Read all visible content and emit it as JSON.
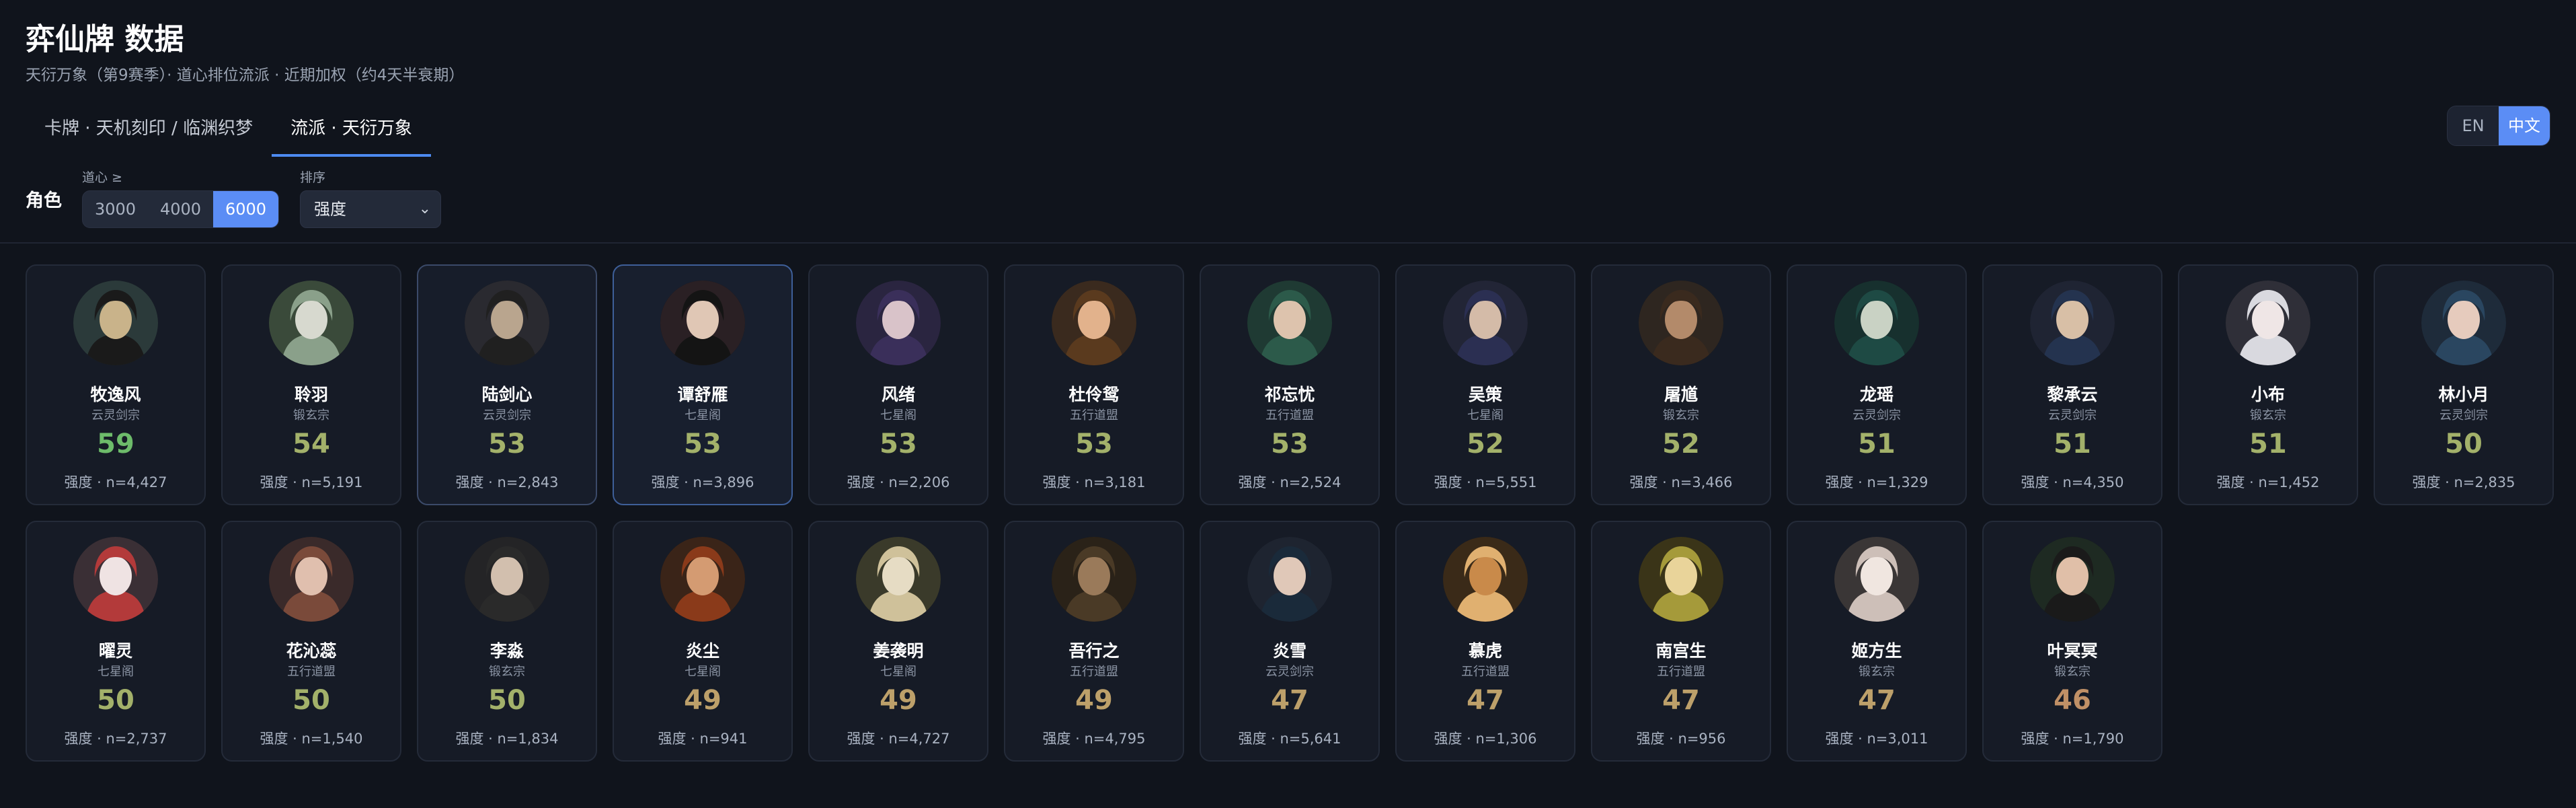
{
  "header": {
    "title": "弈仙牌 数据",
    "subtitle": "天衍万象（第9赛季）· 道心排位流派 · 近期加权（约4天半衰期）"
  },
  "tabs": [
    {
      "label": "卡牌 · 天机刻印 / 临渊织梦",
      "active": false
    },
    {
      "label": "流派 · 天衍万象",
      "active": true
    }
  ],
  "lang": {
    "en": "EN",
    "zh": "中文",
    "active": "zh"
  },
  "filters": {
    "section_label": "角色",
    "daoxin_label": "道心 ≥",
    "daoxin_options": [
      "3000",
      "4000",
      "6000"
    ],
    "daoxin_selected": "6000",
    "sort_label": "排序",
    "sort_value": "强度"
  },
  "colors": {
    "accent": "#5b8df5",
    "score_high": "#6dbb6a",
    "score_mid": "#a3b16a",
    "score_low": "#bda06a",
    "score_lowest": "#c09066"
  },
  "characters": [
    {
      "name": "牧逸风",
      "sect": "云灵剑宗",
      "score": 59,
      "stat": "强度 · n=4,427"
    },
    {
      "name": "聆羽",
      "sect": "锻玄宗",
      "score": 54,
      "stat": "强度 · n=5,191"
    },
    {
      "name": "陆剑心",
      "sect": "云灵剑宗",
      "score": 53,
      "stat": "强度 · n=2,843"
    },
    {
      "name": "谭舒雁",
      "sect": "七星阁",
      "score": 53,
      "stat": "强度 · n=3,896"
    },
    {
      "name": "风绪",
      "sect": "七星阁",
      "score": 53,
      "stat": "强度 · n=2,206"
    },
    {
      "name": "杜伶鸳",
      "sect": "五行道盟",
      "score": 53,
      "stat": "强度 · n=3,181"
    },
    {
      "name": "祁忘忧",
      "sect": "五行道盟",
      "score": 53,
      "stat": "强度 · n=2,524"
    },
    {
      "name": "吴策",
      "sect": "七星阁",
      "score": 52,
      "stat": "强度 · n=5,551"
    },
    {
      "name": "屠馗",
      "sect": "锻玄宗",
      "score": 52,
      "stat": "强度 · n=3,466"
    },
    {
      "name": "龙瑶",
      "sect": "云灵剑宗",
      "score": 51,
      "stat": "强度 · n=1,329"
    },
    {
      "name": "黎承云",
      "sect": "云灵剑宗",
      "score": 51,
      "stat": "强度 · n=4,350"
    },
    {
      "name": "小布",
      "sect": "锻玄宗",
      "score": 51,
      "stat": "强度 · n=1,452"
    },
    {
      "name": "林小月",
      "sect": "云灵剑宗",
      "score": 50,
      "stat": "强度 · n=2,835"
    },
    {
      "name": "曜灵",
      "sect": "七星阁",
      "score": 50,
      "stat": "强度 · n=2,737"
    },
    {
      "name": "花沁蕊",
      "sect": "五行道盟",
      "score": 50,
      "stat": "强度 · n=1,540"
    },
    {
      "name": "李淼",
      "sect": "锻玄宗",
      "score": 50,
      "stat": "强度 · n=1,834"
    },
    {
      "name": "炎尘",
      "sect": "七星阁",
      "score": 49,
      "stat": "强度 · n=941"
    },
    {
      "name": "姜袭明",
      "sect": "七星阁",
      "score": 49,
      "stat": "强度 · n=4,727"
    },
    {
      "name": "吾行之",
      "sect": "五行道盟",
      "score": 49,
      "stat": "强度 · n=4,795"
    },
    {
      "name": "炎雪",
      "sect": "云灵剑宗",
      "score": 47,
      "stat": "强度 · n=5,641"
    },
    {
      "name": "慕虎",
      "sect": "五行道盟",
      "score": 47,
      "stat": "强度 · n=1,306"
    },
    {
      "name": "南宫生",
      "sect": "五行道盟",
      "score": 47,
      "stat": "强度 · n=956"
    },
    {
      "name": "姬方生",
      "sect": "锻玄宗",
      "score": 47,
      "stat": "强度 · n=3,011"
    },
    {
      "name": "叶冥冥",
      "sect": "锻玄宗",
      "score": 46,
      "stat": "强度 · n=1,790"
    }
  ]
}
